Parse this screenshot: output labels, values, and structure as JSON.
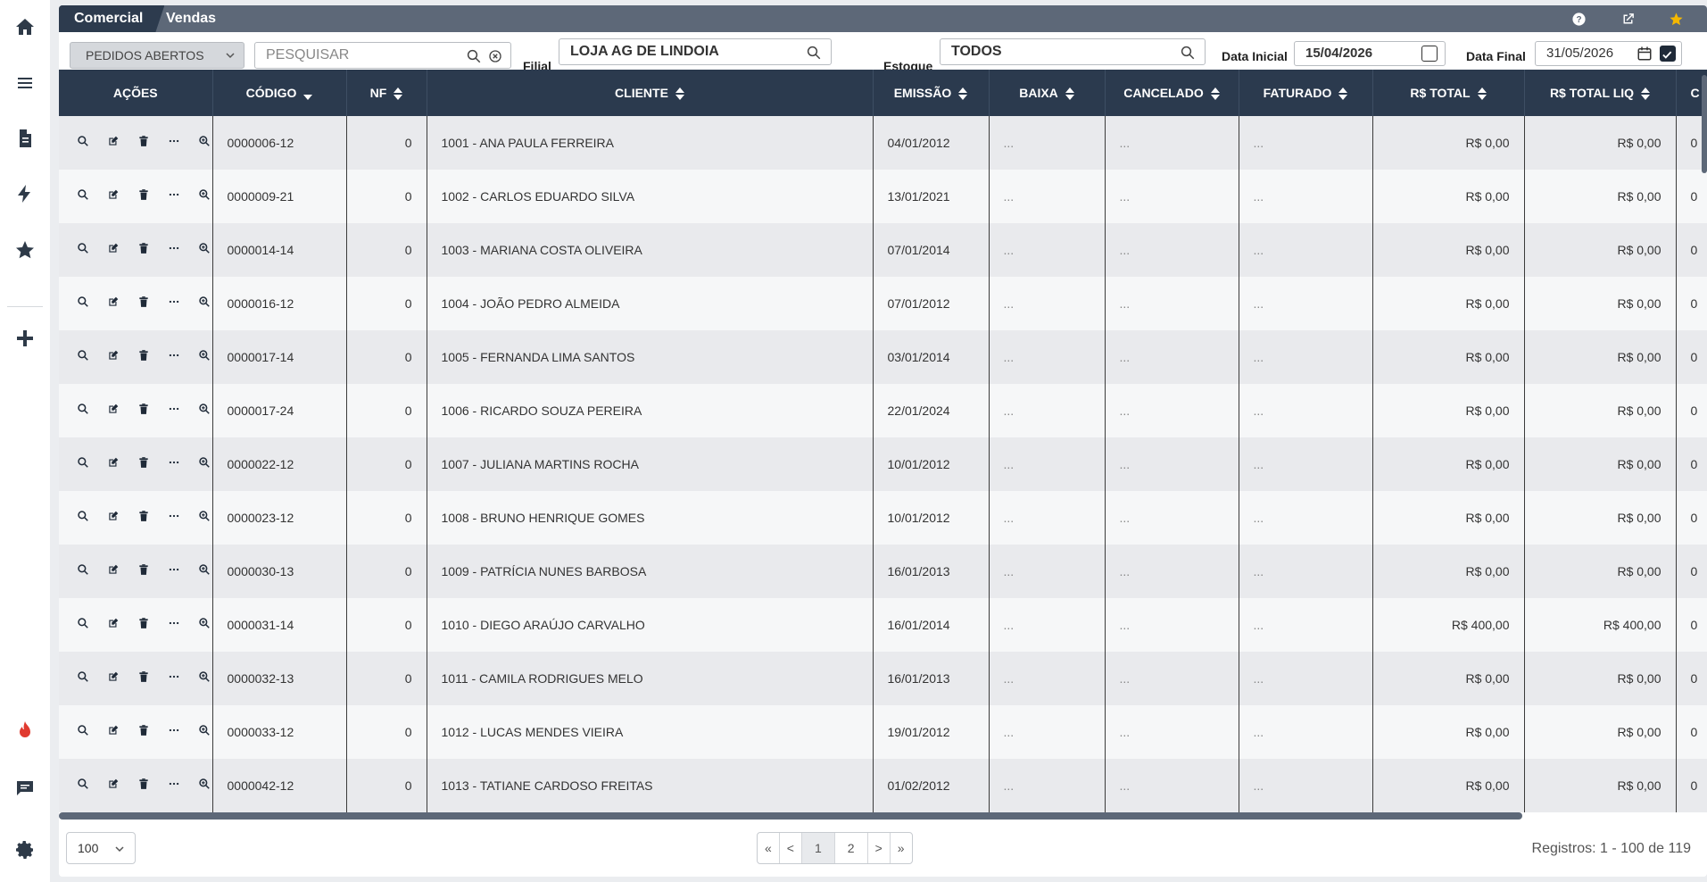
{
  "breadcrumb": {
    "section": "Comercial",
    "page": "Vendas"
  },
  "filters": {
    "status_select": "PEDIDOS ABERTOS",
    "search_placeholder": "PESQUISAR",
    "filial_label": "Filial",
    "filial_value": "LOJA AG DE LINDOIA",
    "estoque_label": "Estoque",
    "estoque_value": "TODOS",
    "data_inicial_label": "Data Inicial",
    "data_inicial_value": "15/04/2026",
    "data_inicial_checked": false,
    "data_final_label": "Data Final",
    "data_final_value": "31/05/2026",
    "data_final_checked": true
  },
  "table": {
    "headers": [
      "AÇÕES",
      "CÓDIGO",
      "NF",
      "CLIENTE",
      "EMISSÃO",
      "BAIXA",
      "CANCELADO",
      "FATURADO",
      "R$ TOTAL",
      "R$ TOTAL LIQ",
      "C"
    ],
    "rows": [
      {
        "codigo": "0000006-12",
        "nf": "0",
        "cliente": "1001 - ANA PAULA FERREIRA",
        "emissao": "04/01/2012",
        "baixa": "...",
        "cancelado": "...",
        "faturado": "...",
        "total": "R$ 0,00",
        "total_liq": "R$ 0,00",
        "extra": "0"
      },
      {
        "codigo": "0000009-21",
        "nf": "0",
        "cliente": "1002 - CARLOS EDUARDO SILVA",
        "emissao": "13/01/2021",
        "baixa": "...",
        "cancelado": "...",
        "faturado": "...",
        "total": "R$ 0,00",
        "total_liq": "R$ 0,00",
        "extra": "0"
      },
      {
        "codigo": "0000014-14",
        "nf": "0",
        "cliente": "1003 - MARIANA COSTA OLIVEIRA",
        "emissao": "07/01/2014",
        "baixa": "...",
        "cancelado": "...",
        "faturado": "...",
        "total": "R$ 0,00",
        "total_liq": "R$ 0,00",
        "extra": "0"
      },
      {
        "codigo": "0000016-12",
        "nf": "0",
        "cliente": "1004 - JOÃO PEDRO ALMEIDA",
        "emissao": "07/01/2012",
        "baixa": "...",
        "cancelado": "...",
        "faturado": "...",
        "total": "R$ 0,00",
        "total_liq": "R$ 0,00",
        "extra": "0"
      },
      {
        "codigo": "0000017-14",
        "nf": "0",
        "cliente": "1005 - FERNANDA LIMA SANTOS",
        "emissao": "03/01/2014",
        "baixa": "...",
        "cancelado": "...",
        "faturado": "...",
        "total": "R$ 0,00",
        "total_liq": "R$ 0,00",
        "extra": "0"
      },
      {
        "codigo": "0000017-24",
        "nf": "0",
        "cliente": "1006 - RICARDO SOUZA PEREIRA",
        "emissao": "22/01/2024",
        "baixa": "...",
        "cancelado": "...",
        "faturado": "...",
        "total": "R$ 0,00",
        "total_liq": "R$ 0,00",
        "extra": "0"
      },
      {
        "codigo": "0000022-12",
        "nf": "0",
        "cliente": "1007 - JULIANA MARTINS ROCHA",
        "emissao": "10/01/2012",
        "baixa": "...",
        "cancelado": "...",
        "faturado": "...",
        "total": "R$ 0,00",
        "total_liq": "R$ 0,00",
        "extra": "0"
      },
      {
        "codigo": "0000023-12",
        "nf": "0",
        "cliente": "1008 - BRUNO HENRIQUE GOMES",
        "emissao": "10/01/2012",
        "baixa": "...",
        "cancelado": "...",
        "faturado": "...",
        "total": "R$ 0,00",
        "total_liq": "R$ 0,00",
        "extra": "0"
      },
      {
        "codigo": "0000030-13",
        "nf": "0",
        "cliente": "1009 - PATRÍCIA NUNES BARBOSA",
        "emissao": "16/01/2013",
        "baixa": "...",
        "cancelado": "...",
        "faturado": "...",
        "total": "R$ 0,00",
        "total_liq": "R$ 0,00",
        "extra": "0"
      },
      {
        "codigo": "0000031-14",
        "nf": "0",
        "cliente": "1010 - DIEGO ARAÚJO CARVALHO",
        "emissao": "16/01/2014",
        "baixa": "...",
        "cancelado": "...",
        "faturado": "...",
        "total": "R$ 400,00",
        "total_liq": "R$ 400,00",
        "extra": "0"
      },
      {
        "codigo": "0000032-13",
        "nf": "0",
        "cliente": "1011 - CAMILA RODRIGUES MELO",
        "emissao": "16/01/2013",
        "baixa": "...",
        "cancelado": "...",
        "faturado": "...",
        "total": "R$ 0,00",
        "total_liq": "R$ 0,00",
        "extra": "0"
      },
      {
        "codigo": "0000033-12",
        "nf": "0",
        "cliente": "1012 - LUCAS MENDES VIEIRA",
        "emissao": "19/01/2012",
        "baixa": "...",
        "cancelado": "...",
        "faturado": "...",
        "total": "R$ 0,00",
        "total_liq": "R$ 0,00",
        "extra": "0"
      },
      {
        "codigo": "0000042-12",
        "nf": "0",
        "cliente": "1013 - TATIANE CARDOSO FREITAS",
        "emissao": "01/02/2012",
        "baixa": "...",
        "cancelado": "...",
        "faturado": "...",
        "total": "R$ 0,00",
        "total_liq": "R$ 0,00",
        "extra": "0"
      }
    ]
  },
  "footer": {
    "page_size": "100",
    "pager": {
      "first": "«",
      "prev": "<",
      "page1": "1",
      "page2": "2",
      "next": ">",
      "last": "»"
    },
    "records": "Registros: 1 - 100 de 119"
  },
  "colors": {
    "header_bg": "#2b3a4e",
    "topbar_bg": "#5d6878",
    "accent_star": "#f5b800",
    "brand_flame": "#e03a2f"
  }
}
